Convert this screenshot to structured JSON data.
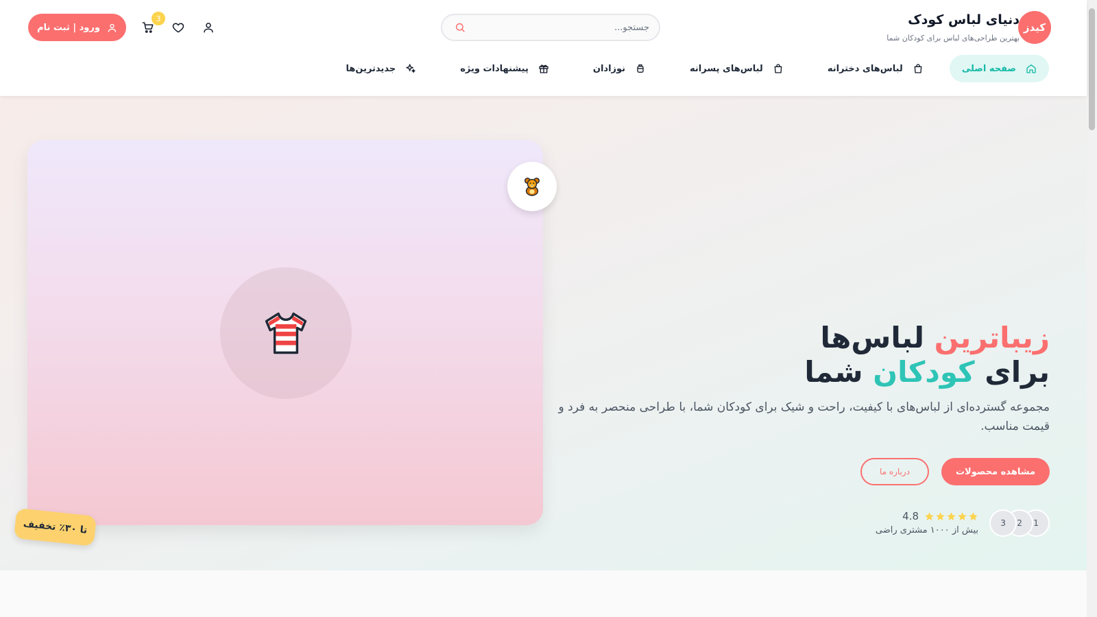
{
  "brand": {
    "logo_text": "کیدز",
    "title": "دنیای لباس کودک",
    "tagline": "بهترین طراحی‌های لباس برای کودکان شما"
  },
  "search": {
    "placeholder": "جستجو..."
  },
  "header": {
    "cart_count": "3",
    "login_label": "ورود | ثبت نام"
  },
  "nav": {
    "items": [
      {
        "label": "صفحه اصلی",
        "icon": "home-icon",
        "active": true
      },
      {
        "label": "لباس‌های دخترانه",
        "icon": "shopping-bag-icon"
      },
      {
        "label": "لباس‌های پسرانه",
        "icon": "shopping-bag-icon"
      },
      {
        "label": "نوزادان",
        "icon": "baby-bottle-icon"
      },
      {
        "label": "پیشنهادات ویژه",
        "icon": "gift-icon"
      },
      {
        "label": "جدیدترین‌ها",
        "icon": "sparkle-icon"
      }
    ]
  },
  "hero": {
    "headline_word1": "زیباترین",
    "headline_word2": "لباس‌ها",
    "headline_word3": "برای",
    "headline_word4": "کودکان",
    "headline_word5": "شما",
    "description": "مجموعه گسترده‌ای از لباس‌های با کیفیت، راحت و شیک برای کودکان شما، با طراحی منحصر به فرد و قیمت مناسب.",
    "primary_button": "مشاهده محصولات",
    "secondary_button": "درباره ما",
    "avatars": [
      "1",
      "2",
      "3"
    ],
    "rating_value": "4.8",
    "rating_stars": 5,
    "customers_text": "بیش از ۱۰۰۰ مشتری راضی",
    "discount_badge": "تا ۳۰٪ تخفیف",
    "card_icon": "t-shirt-icon",
    "bubble_icon": "teddy-bear-icon"
  },
  "colors": {
    "brand_coral": "#fb6f6f",
    "brand_teal": "#2ec4b6",
    "badge_yellow": "#fcd34d",
    "active_nav_bg": "#e0f7f4"
  }
}
